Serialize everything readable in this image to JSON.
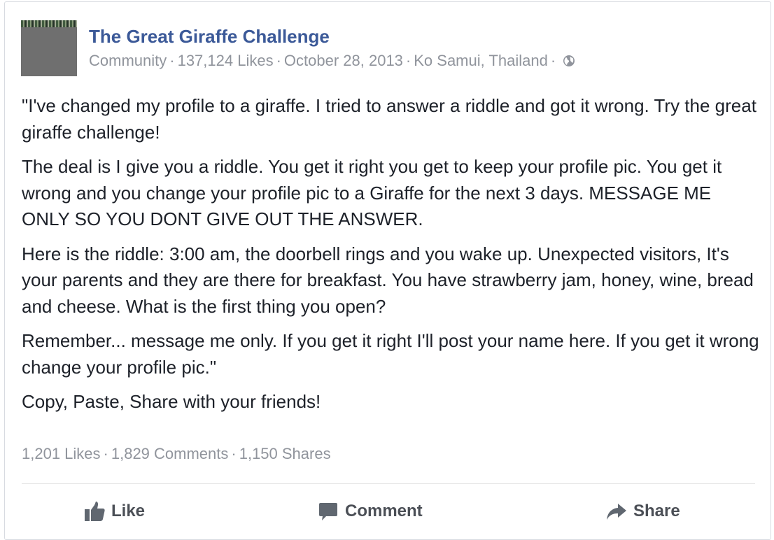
{
  "post": {
    "page_name": "The Great Giraffe Challenge",
    "meta": {
      "category": "Community",
      "page_likes": "137,124 Likes",
      "date": "October 28, 2013",
      "location": "Ko Samui, Thailand",
      "separator": "·",
      "audience_icon": "globe-icon"
    },
    "paragraphs": [
      "\"I've changed my profile to a giraffe. I tried to answer a riddle and got it wrong. Try the great giraffe challenge!",
      "The deal is I give you a riddle. You get it right you get to keep your profile pic. You get it wrong and you change your profile pic to a Giraffe for the next 3 days. MESSAGE ME ONLY SO YOU DONT GIVE OUT THE ANSWER.",
      "Here is the riddle: 3:00 am, the doorbell rings and you wake up. Unexpected visitors, It's your parents and they are there for breakfast. You have strawberry jam, honey, wine, bread and cheese. What is the first thing you open?",
      "Remember... message me only. If you get it right I'll post your name here. If you get it wrong change your profile pic.\"",
      "Copy, Paste, Share with your friends!"
    ],
    "stats": {
      "likes": "1,201 Likes",
      "comments": "1,829 Comments",
      "shares": "1,150 Shares",
      "separator": "·"
    },
    "actions": {
      "like_label": "Like",
      "like_icon": "thumbs-up-icon",
      "comment_label": "Comment",
      "comment_icon": "speech-bubble-icon",
      "share_label": "Share",
      "share_icon": "share-arrow-icon"
    }
  },
  "colors": {
    "page_name": "#3b5998",
    "meta_text": "#90949c",
    "body_text": "#1d2129",
    "action_text": "#4b4f56",
    "divider": "#e5e5e5"
  }
}
